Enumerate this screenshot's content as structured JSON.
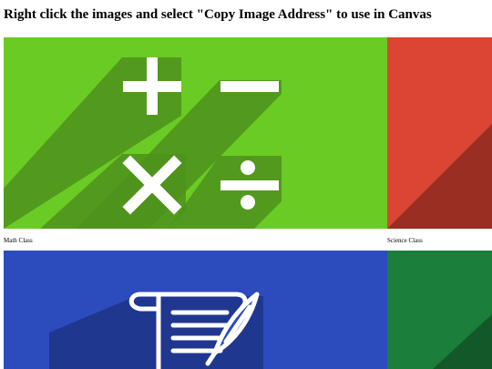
{
  "page": {
    "heading": "Right click the images and select \"Copy Image Address\" to use in Canvas"
  },
  "images": [
    {
      "caption": "Math Class",
      "icon": "math-operators-icon",
      "color": "#6acb24",
      "shadow": "#4e921c"
    },
    {
      "caption": "Science Class",
      "icon": "science-icon",
      "color": "#db4533",
      "shadow": "#9b2e22"
    },
    {
      "caption": "",
      "icon": "scroll-quill-icon",
      "color": "#2c4bbd",
      "shadow": "#1f3488"
    },
    {
      "caption": "",
      "icon": "unknown-icon",
      "color": "#1b7e3a",
      "shadow": "#125829"
    }
  ]
}
